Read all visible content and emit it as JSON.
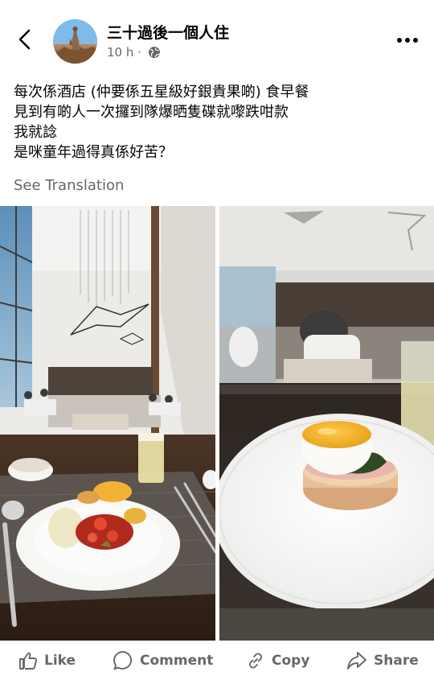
{
  "header": {
    "author": "三十過後一個人住",
    "time": "10 h",
    "separator": "·",
    "back_icon": "chevron-left-icon",
    "privacy_icon": "globe-icon",
    "more_icon": "more-horizontal-icon"
  },
  "post": {
    "lines": [
      "每次係酒店 (仲要係五星級好銀貴果啲) 食早餐",
      "見到有啲人一次攞到隊爆晒隻碟就嚟跌咁款",
      "我就諗",
      "是咪童年過得真係好苦？"
    ],
    "see_translation": "See Translation"
  },
  "photos": [
    {
      "name": "hotel-restaurant-breakfast-plate-photo"
    },
    {
      "name": "eggs-benedict-closeup-photo"
    }
  ],
  "actions": [
    {
      "label": "Like",
      "icon": "thumbs-up-icon"
    },
    {
      "label": "Comment",
      "icon": "comment-icon"
    },
    {
      "label": "Copy",
      "icon": "link-icon"
    },
    {
      "label": "Share",
      "icon": "share-icon"
    }
  ],
  "colors": {
    "text": "#050505",
    "secondary": "#65676b",
    "background": "#ffffff"
  }
}
